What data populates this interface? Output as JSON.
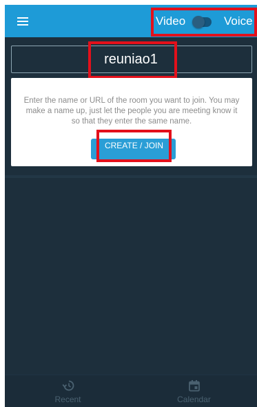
{
  "app_bar": {
    "menu_icon": "hamburger-menu-icon",
    "mode_toggle": {
      "left_label": "Video",
      "right_label": "Voice",
      "selected": "Video"
    }
  },
  "room": {
    "value": "reuniao1"
  },
  "info_card": {
    "text": "Enter the name or URL of the room you want to join. You may make a name up, just let the people you are meeting know it so that they enter the same name.",
    "button_label": "CREATE / JOIN"
  },
  "bottom_nav": {
    "items": [
      {
        "label": "Recent",
        "icon": "history-icon"
      },
      {
        "label": "Calendar",
        "icon": "calendar-icon"
      }
    ]
  },
  "colors": {
    "app_bar": "#1e9bd7",
    "background": "#1d2f3c",
    "button": "#2a9ed6",
    "highlight": "#e3101b"
  }
}
